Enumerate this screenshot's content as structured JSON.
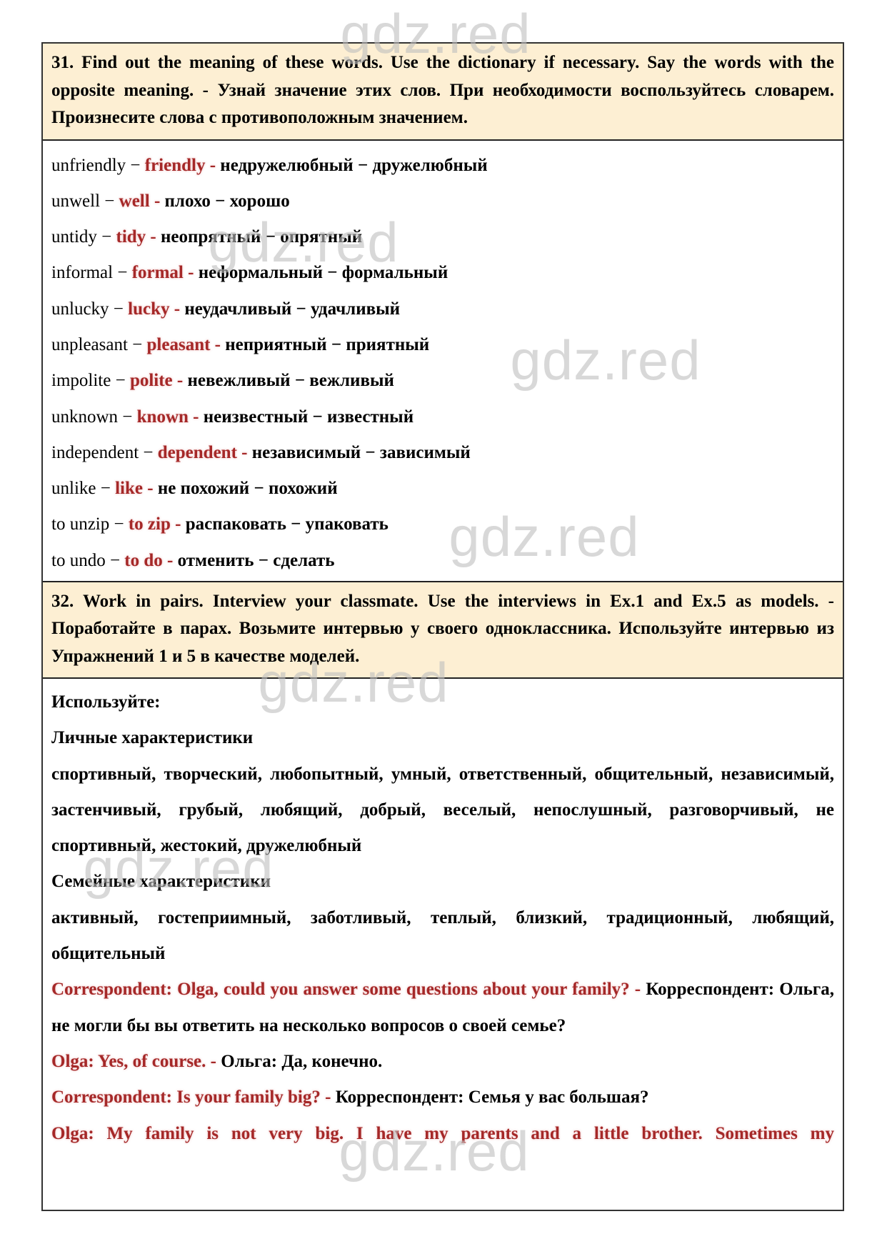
{
  "exercise31": {
    "header": "31. Find out the meaning of these words. Use the dictionary if necessary. Say the words with the opposite meaning. - Узнай значение этих слов. При необходимости воспользуйтесь словарем. Произнесите слова с противоположным значением.",
    "rows": [
      {
        "word": "unfriendly − ",
        "opposite": "friendly - ",
        "translation": "недружелюбный − дружелюбный"
      },
      {
        "word": "unwell − ",
        "opposite": "well - ",
        "translation": "плохо − хорошо"
      },
      {
        "word": "untidy − ",
        "opposite": "tidy - ",
        "translation": "неопрятный − опрятный"
      },
      {
        "word": "informal − ",
        "opposite": "formal - ",
        "translation": "неформальный − формальный"
      },
      {
        "word": "unlucky − ",
        "opposite": "lucky - ",
        "translation": "неудачливый − удачливый"
      },
      {
        "word": "unpleasant − ",
        "opposite": "pleasant - ",
        "translation": "неприятный − приятный"
      },
      {
        "word": "impolite − ",
        "opposite": "polite - ",
        "translation": "невежливый − вежливый"
      },
      {
        "word": "unknown − ",
        "opposite": "known - ",
        "translation": "неизвестный − известный"
      },
      {
        "word": "independent − ",
        "opposite": "dependent - ",
        "translation": "независимый − зависимый"
      },
      {
        "word": "unlike − ",
        "opposite": "like - ",
        "translation": "не похожий − похожий"
      },
      {
        "word": "to unzip − ",
        "opposite": "to zip - ",
        "translation": "распаковать − упаковать"
      },
      {
        "word": "to undo − ",
        "opposite": "to do - ",
        "translation": "отменить − сделать"
      }
    ]
  },
  "exercise32": {
    "header": "32. Work in pairs. Interview your classmate. Use the interviews in Ex.1 and Ex.5 as models. - Поработайте в парах. Возьмите интервью у своего одноклассника. Используйте интервью из Упражнений 1 и 5 в качестве моделей.",
    "use_label": "Используйте:",
    "personal_title": "Личные характеристики",
    "personal_list": "спортивный, творческий, любопытный, умный, ответственный, общительный, независимый, застенчивый, грубый, любящий, добрый, веселый, непослушный, разговорчивый, не спортивный, жестокий, дружелюбный",
    "family_title": "Семейные характеристики",
    "family_list": "активный, гостеприимный, заботливый, теплый, близкий, традиционный, любящий, общительный",
    "dialogue": [
      {
        "en": "Correspondent: Olga, could you answer some questions about your family? - ",
        "ru": "Корреспондент: Ольга, не могли бы вы ответить на несколько вопросов о своей семье?"
      },
      {
        "en": "Olga: Yes, of course. - ",
        "ru": "Ольга: Да, конечно."
      },
      {
        "en": "Correspondent: Is your family big? - ",
        "ru": "Корреспондент: Семья у вас большая?"
      },
      {
        "en": "Olga: My family is not very big. I have my parents and a little brother. Sometimes my",
        "ru": ""
      }
    ]
  },
  "watermark": "gdz.red",
  "colors": {
    "accent_red": "#A52828",
    "header_bg": "#FDEFD3",
    "watermark": "#D9D9D9"
  }
}
